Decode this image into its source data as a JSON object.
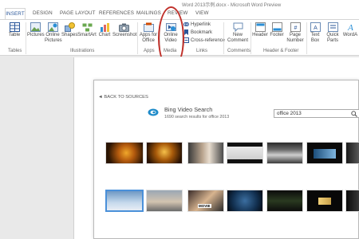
{
  "window": {
    "title": "Word 2013示例.docx - Microsoft Word Preview"
  },
  "tabs": [
    {
      "label": "INSERT",
      "active": true
    },
    {
      "label": "DESIGN"
    },
    {
      "label": "PAGE LAYOUT"
    },
    {
      "label": "REFERENCES"
    },
    {
      "label": "MAILINGS"
    },
    {
      "label": "REVIEW"
    },
    {
      "label": "VIEW"
    }
  ],
  "ribbon": {
    "tables": {
      "table": "Table",
      "group": "Tables"
    },
    "illustrations": {
      "pictures": "Pictures",
      "online_pictures_1": "Online",
      "online_pictures_2": "Pictures",
      "shapes": "Shapes",
      "smartart": "SmartArt",
      "chart": "Chart",
      "screenshot": "Screenshot",
      "group": "Illustrations"
    },
    "apps": {
      "apps_1": "Apps for",
      "apps_2": "Office",
      "group": "Apps"
    },
    "media": {
      "video_1": "Online",
      "video_2": "Video",
      "group": "Media"
    },
    "links": {
      "hyperlink": "Hyperlink",
      "bookmark": "Bookmark",
      "cross_reference": "Cross-reference",
      "group": "Links"
    },
    "comments": {
      "new_1": "New",
      "new_2": "Comment",
      "group": "Comments"
    },
    "header_footer": {
      "header": "Header",
      "footer": "Footer",
      "page_number_1": "Page",
      "page_number_2": "Number",
      "group": "Header & Footer"
    },
    "text": {
      "text_box_1": "Text",
      "text_box_2": "Box",
      "quick_parts_1": "Quick",
      "quick_parts_2": "Parts",
      "wordart": "WordA"
    }
  },
  "dialog": {
    "back_link": "◄ BACK TO SOURCES",
    "source_title": "Bing Video Search",
    "results_text": "1690 search results for office 2013",
    "search_value": "office 2013"
  },
  "thumb_colors": {
    "amber": "#c27a16",
    "dark": "#1a1a1a",
    "accent": "#2b579a",
    "highlight": "#c0302a"
  }
}
